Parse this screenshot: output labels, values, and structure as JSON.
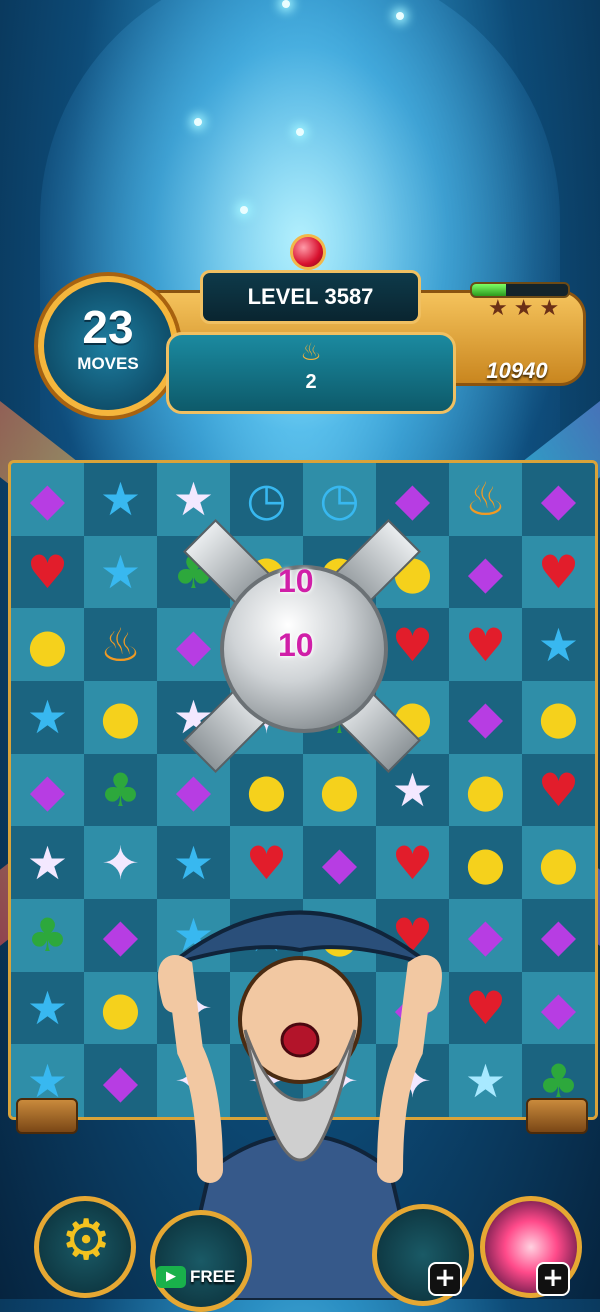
{
  "header": {
    "level_label": "LEVEL",
    "level_number": "3587",
    "moves_count": "23",
    "moves_label": "MOVES",
    "goal_icon": "magic-lamp-icon",
    "goal_remaining": "2",
    "score": "10940",
    "star_progress": 0.35,
    "stars_earned": 0,
    "stars_total": 3
  },
  "board": {
    "columns": 8,
    "rows": 9,
    "cells": [
      [
        "purple",
        "blue-star",
        "white-star",
        "clock",
        "clock",
        "purple",
        "lamp",
        "purple"
      ],
      [
        "red",
        "blue-star",
        "green",
        "yellow",
        "yellow",
        "yellow",
        "purple",
        "red"
      ],
      [
        "yellow",
        "lamp",
        "purple",
        "white",
        "green",
        "red",
        "red",
        "blue-star"
      ],
      [
        "blue-star",
        "yellow",
        "white-star",
        "white",
        "green",
        "yellow",
        "purple",
        "yellow"
      ],
      [
        "purple",
        "green",
        "purple",
        "yellow",
        "yellow",
        "white-star",
        "yellow",
        "red"
      ],
      [
        "white-star",
        "white",
        "blue-star",
        "red",
        "purple",
        "red",
        "yellow",
        "yellow"
      ],
      [
        "green",
        "purple",
        "blue-star",
        "blue-star",
        "yellow",
        "red",
        "purple",
        "purple"
      ],
      [
        "blue-star",
        "yellow",
        "white",
        "yellow",
        "white",
        "purple",
        "red",
        "purple"
      ],
      [
        "blue-star",
        "ice-purple",
        "white",
        "white",
        "white",
        "white",
        "ice-blue",
        "green"
      ]
    ],
    "bonus_points": [
      "10",
      "10"
    ]
  },
  "footer": {
    "settings_icon": "gear-icon",
    "free_label": "FREE",
    "video_icon": "video-play-icon",
    "booster_icon": "rainbow-orb-icon"
  },
  "colors": {
    "accent_gold": "#f0c062",
    "points_magenta": "#d01fa8"
  }
}
